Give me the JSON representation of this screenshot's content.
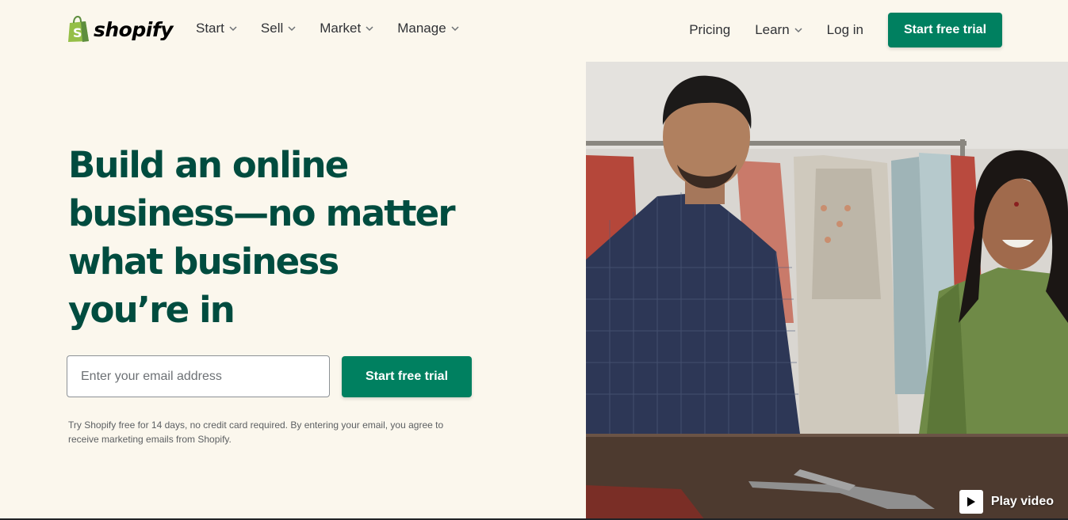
{
  "header": {
    "logo_text": "shopify",
    "nav_left": [
      {
        "label": "Start",
        "icon": "chevron-down-icon"
      },
      {
        "label": "Sell",
        "icon": "chevron-down-icon"
      },
      {
        "label": "Market",
        "icon": "chevron-down-icon"
      },
      {
        "label": "Manage",
        "icon": "chevron-down-icon"
      }
    ],
    "pricing_label": "Pricing",
    "learn_label": "Learn",
    "login_label": "Log in",
    "cta_label": "Start free trial"
  },
  "hero": {
    "title_lines": [
      "Build an online",
      "business—no matter",
      "what business",
      "you’re in"
    ],
    "email_placeholder": "Enter your email address",
    "cta_label": "Start free trial",
    "disclaimer_line1": "Try Shopify free for 14 days, no credit card required. By entering your email, you agree to",
    "disclaimer_line2": "receive marketing emails from Shopify."
  },
  "media": {
    "play_label": "Play video",
    "play_icon": "play-icon"
  },
  "colors": {
    "brand_green": "#008060",
    "heading_green": "#004c3f",
    "background": "#fbf7ed",
    "logo_bag": "#95bf47"
  }
}
